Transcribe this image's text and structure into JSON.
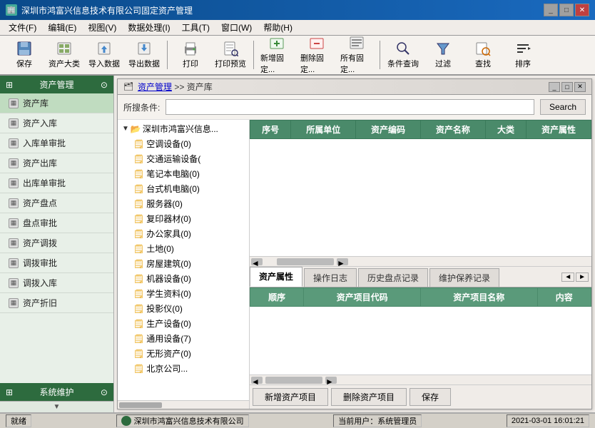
{
  "titleBar": {
    "title": "深圳市鸿富兴信息技术有限公司固定资产管理",
    "controls": [
      "_",
      "□",
      "✕"
    ]
  },
  "menuBar": {
    "items": [
      "文件(F)",
      "编辑(E)",
      "视图(V)",
      "数据处理(I)",
      "工具(T)",
      "窗口(W)",
      "帮助(H)"
    ]
  },
  "toolbar": {
    "buttons": [
      {
        "label": "保存",
        "icon": "💾"
      },
      {
        "label": "资产大类",
        "icon": "📋"
      },
      {
        "label": "导入数据",
        "icon": "📥"
      },
      {
        "label": "导出数据",
        "icon": "📤"
      },
      {
        "label": "打印",
        "icon": "🖨"
      },
      {
        "label": "打印预览",
        "icon": "🔍"
      },
      {
        "label": "新增固定...",
        "icon": "➕"
      },
      {
        "label": "删除固定...",
        "icon": "❌"
      },
      {
        "label": "所有固定...",
        "icon": "📄"
      },
      {
        "label": "条件查询",
        "icon": "🔎"
      },
      {
        "label": "过滤",
        "icon": "⚗"
      },
      {
        "label": "查找",
        "icon": "🔍"
      },
      {
        "label": "排序",
        "icon": "↕"
      }
    ]
  },
  "sidebar": {
    "section1": {
      "label": "资产管理",
      "icon": "⊞"
    },
    "items1": [
      {
        "label": "资产库",
        "active": true
      },
      {
        "label": "资产入库"
      },
      {
        "label": "入库单审批"
      },
      {
        "label": "资产出库"
      },
      {
        "label": "出库单审批"
      },
      {
        "label": "资产盘点"
      },
      {
        "label": "盘点审批"
      },
      {
        "label": "资产调拨"
      },
      {
        "label": "调拨审批"
      },
      {
        "label": "调拨入库"
      },
      {
        "label": "资产折旧"
      }
    ],
    "section2": {
      "label": "系统维护",
      "icon": "⊞"
    }
  },
  "innerWindow": {
    "title": "资产管理 >> 资产库",
    "breadcrumb1": "资产管理",
    "breadcrumb2": "资产库"
  },
  "searchBar": {
    "label": "所搜条件:",
    "placeholder": "",
    "buttonLabel": "Search"
  },
  "treeData": {
    "rootNode": "深圳市鸿富兴信息...",
    "children": [
      "空调设备(0)",
      "交通运输设备(",
      "笔记本电脑(0)",
      "台式机电脑(0)",
      "服务器(0)",
      "复印器材(0)",
      "办公家具(0)",
      "土地(0)",
      "房屋建筑(0)",
      "机器设备(0)",
      "学生资料(0)",
      "投影仪(0)",
      "生产设备(0)",
      "通用设备(7)",
      "无形资产(0)",
      "北京公司..."
    ]
  },
  "assetTable": {
    "columns": [
      "序号",
      "所属单位",
      "资产编码",
      "资产名称",
      "大类",
      "资产属性"
    ],
    "rows": []
  },
  "bottomTabs": {
    "tabs": [
      "资产属性",
      "操作日志",
      "历史盘点记录",
      "维护保养记录"
    ],
    "activeTab": "资产属性",
    "subColumns": [
      "顺序",
      "资产项目代码",
      "资产项目名称",
      "内容"
    ],
    "subRows": []
  },
  "actionButtons": [
    "新增资产项目",
    "删除资产项目",
    "保存"
  ],
  "statusBar": {
    "status": "就绪",
    "company": "深圳市鸿富兴信息技术有限公司",
    "user": "当前用户：系统管理员",
    "datetime": "2021-03-01 16:01:21"
  }
}
